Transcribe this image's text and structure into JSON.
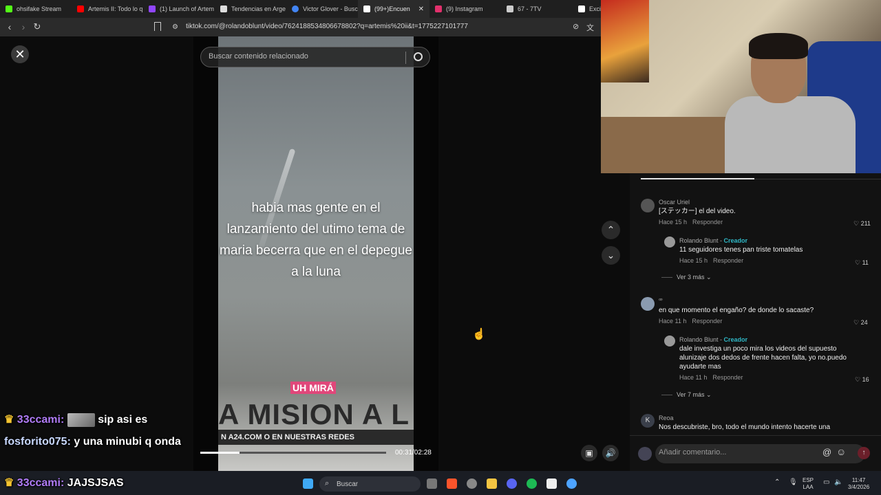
{
  "browser": {
    "tabs": [
      {
        "label": "ohsifake Stream",
        "color": "#53fc18"
      },
      {
        "label": "Artemis II: Todo lo q",
        "color": "#ff0000"
      },
      {
        "label": "(1) Launch of Artem",
        "color": "#9146ff"
      },
      {
        "label": "Tendencias en Arge",
        "color": "#ffffff"
      },
      {
        "label": "Victor Glover - Busc",
        "color": "#4285f4"
      },
      {
        "label": "(99+)Encuen",
        "color": "#ffffff",
        "active": true
      },
      {
        "label": "(9) Instagram",
        "color": "#e1306c"
      },
      {
        "label": "67 - 7TV",
        "color": "#cccccc"
      },
      {
        "label": "Exciti",
        "color": "#ffffff"
      }
    ],
    "url": "tiktok.com/@rolandoblunt/video/7624188534806678802?q=artemis%20ii&t=1775227101777"
  },
  "video": {
    "search_placeholder": "Buscar contenido relacionado",
    "caption": "habia mas gente en el lanzamiento del  utimo tema de maria becerra que en el depegue a la luna",
    "subtitle": "UH MIRÁ",
    "banner": "A MISION A L",
    "strip": "N A24.COM O EN NUESTRAS REDES",
    "time": "00:31/02:28",
    "progress": 0.21
  },
  "comments": [
    {
      "name": "Oscar Uriel",
      "text": "[ステッカー] el del video.",
      "time": "Hace 15 h",
      "reply": "Responder",
      "likes": "211"
    },
    {
      "name": "Rolando Blunt",
      "creator": "Creador",
      "text": "11 seguidores tenes pan triste tomatelas",
      "time": "Hace 15 h",
      "reply": "Responder",
      "likes": "11"
    },
    {
      "more": "Ver 3 más"
    },
    {
      "name": "ꟹ",
      "text": "en que momento el engaño? de donde lo sacaste?",
      "time": "Hace 11 h",
      "reply": "Responder",
      "likes": "24"
    },
    {
      "name": "Rolando Blunt",
      "creator": "Creador",
      "text": "dale investiga un poco mira los videos del supuesto alunizaje dos dedos de frente hacen falta, yo no.puedo ayudarte mas",
      "time": "Hace 11 h",
      "reply": "Responder",
      "likes": "16"
    },
    {
      "more": "Ver 7 más"
    },
    {
      "name": "Reoa",
      "text": "Nos descubriste, bro, todo el mundo intento hacerte una",
      "avatar_letter": "K"
    }
  ],
  "reply_placeholder": "Añadir comentario...",
  "chat": [
    {
      "user": "33ccami:",
      "text": "sip asi es"
    },
    {
      "user": "fosforito075:",
      "text": "y una minubi q onda"
    },
    {
      "user": "33ccami:",
      "text": "JAJSJSAS"
    }
  ],
  "taskbar": {
    "search": "Buscar",
    "lang1": "ESP",
    "lang2": "LAA",
    "time": "11:47",
    "date": "3/4/2026"
  }
}
